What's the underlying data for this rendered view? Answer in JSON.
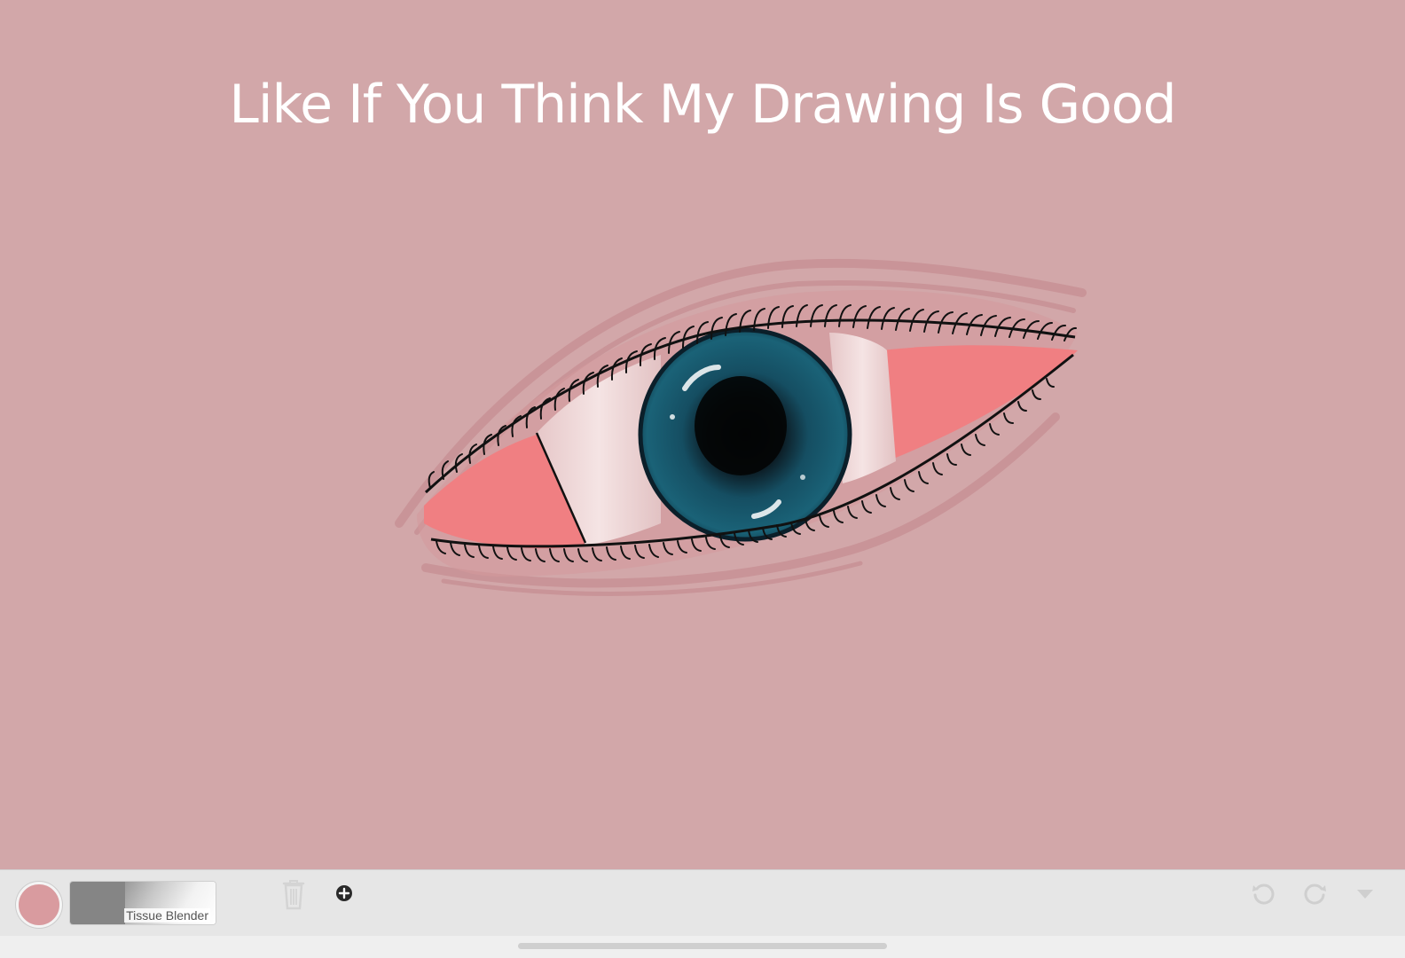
{
  "canvas": {
    "title": "Like If You Think My Drawing Is Good",
    "background_color": "#d2a7a9"
  },
  "toolbar": {
    "color_swatch": "#d99b9f",
    "brush_name": "Tissue Blender",
    "icons": {
      "trash": "trash-icon",
      "add": "plus-circle-icon",
      "undo": "undo-icon",
      "redo": "redo-icon",
      "menu": "caret-down-icon"
    }
  }
}
